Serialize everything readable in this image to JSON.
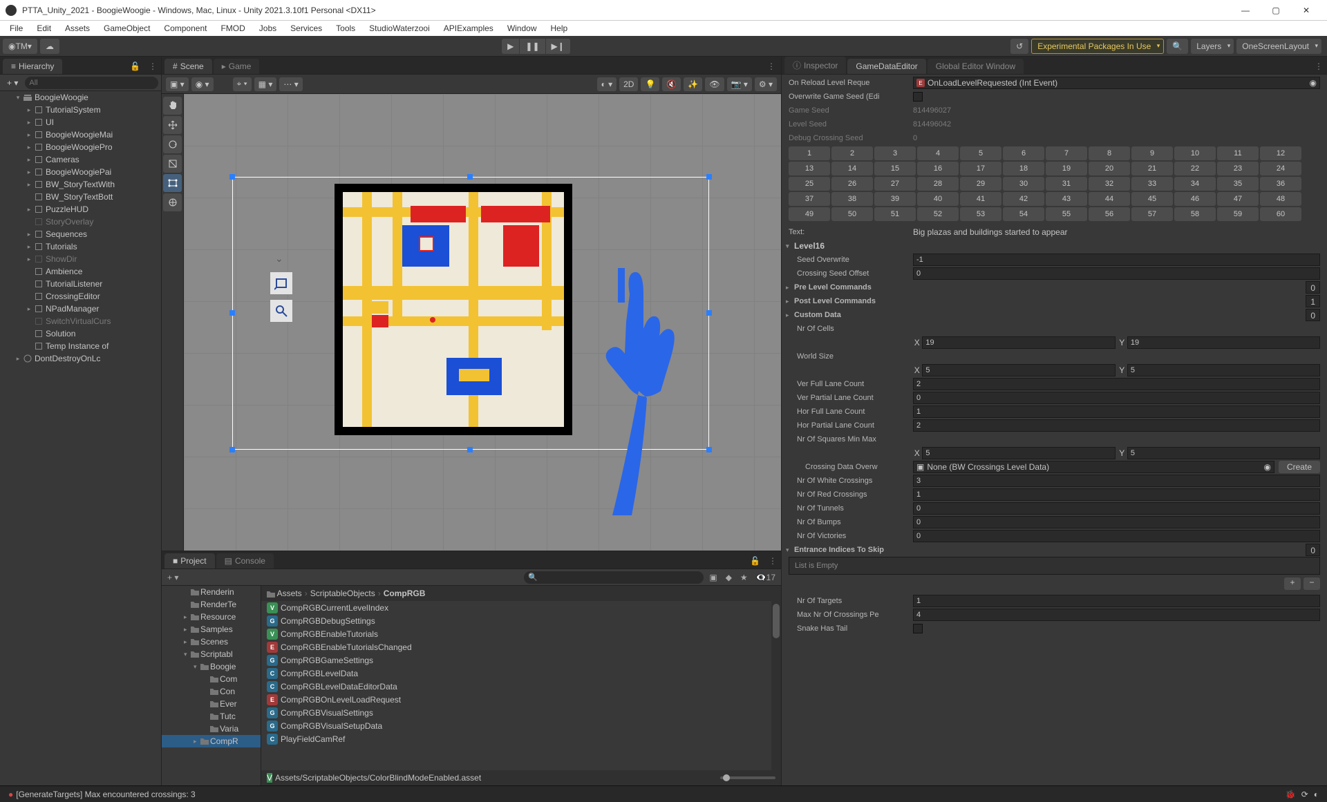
{
  "title": "PTTA_Unity_2021 - BoogieWoogie - Windows, Mac, Linux - Unity 2021.3.10f1 Personal <DX11>",
  "menu": [
    "File",
    "Edit",
    "Assets",
    "GameObject",
    "Component",
    "FMOD",
    "Jobs",
    "Services",
    "Tools",
    "StudioWaterzooi",
    "APIExamples",
    "Window",
    "Help"
  ],
  "toolbar": {
    "tm_label": "TM",
    "exp_packages": "Experimental Packages In Use",
    "layers": "Layers",
    "layout": "OneScreenLayout"
  },
  "hierarchy": {
    "title": "Hierarchy",
    "search_placeholder": "All",
    "scene_name": "BoogieWoogie",
    "items": [
      {
        "name": "TutorialSystem",
        "ind": 2,
        "dim": false,
        "fold": "▸"
      },
      {
        "name": "UI",
        "ind": 2,
        "dim": false,
        "fold": "▸"
      },
      {
        "name": "BoogieWoogieMai",
        "ind": 2,
        "dim": false,
        "fold": "▸"
      },
      {
        "name": "BoogieWoogiePro",
        "ind": 2,
        "dim": false,
        "fold": "▸"
      },
      {
        "name": "Cameras",
        "ind": 2,
        "dim": false,
        "fold": "▸"
      },
      {
        "name": "BoogieWoogiePai",
        "ind": 2,
        "dim": false,
        "fold": "▸"
      },
      {
        "name": "BW_StoryTextWith",
        "ind": 2,
        "dim": false,
        "fold": "▸"
      },
      {
        "name": "BW_StoryTextBott",
        "ind": 2,
        "dim": false,
        "fold": ""
      },
      {
        "name": "PuzzleHUD",
        "ind": 2,
        "dim": false,
        "fold": "▸"
      },
      {
        "name": "StoryOverlay",
        "ind": 2,
        "dim": true,
        "fold": ""
      },
      {
        "name": "Sequences",
        "ind": 2,
        "dim": false,
        "fold": "▸"
      },
      {
        "name": "Tutorials",
        "ind": 2,
        "dim": false,
        "fold": "▸"
      },
      {
        "name": "ShowDir",
        "ind": 2,
        "dim": true,
        "fold": "▸"
      },
      {
        "name": "Ambience",
        "ind": 2,
        "dim": false,
        "fold": ""
      },
      {
        "name": "TutorialListener",
        "ind": 2,
        "dim": false,
        "fold": ""
      },
      {
        "name": "CrossingEditor",
        "ind": 2,
        "dim": false,
        "fold": ""
      },
      {
        "name": "NPadManager",
        "ind": 2,
        "dim": false,
        "fold": "▸"
      },
      {
        "name": "SwitchVirtualCurs",
        "ind": 2,
        "dim": true,
        "fold": ""
      },
      {
        "name": "Solution",
        "ind": 2,
        "dim": false,
        "fold": ""
      },
      {
        "name": "Temp Instance of",
        "ind": 2,
        "dim": false,
        "fold": ""
      }
    ],
    "ddol": "DontDestroyOnLc"
  },
  "scene": {
    "tabs": [
      "Scene",
      "Game"
    ],
    "two_d": "2D"
  },
  "inspector": {
    "tabs": [
      "Inspector",
      "GameDataEditor",
      "Global Editor Window"
    ],
    "on_reload_label": "On Reload Level Reque",
    "on_reload_val": "OnLoadLevelRequested (Int Event)",
    "overwrite_seed_label": "Overwrite Game Seed (Edi",
    "game_seed_label": "Game Seed",
    "game_seed": "814496027",
    "level_seed_label": "Level Seed",
    "level_seed": "814496042",
    "debug_crossing_label": "Debug Crossing Seed",
    "debug_crossing": "0",
    "text_label": "Text:",
    "text_val": "Big plazas and buildings started to appear",
    "level_header": "Level16",
    "seed_ow_label": "Seed Overwrite",
    "seed_ow": "-1",
    "cross_off_label": "Crossing Seed Offset",
    "cross_off": "0",
    "pre_cmd": "Pre Level Commands",
    "pre_cmd_n": "0",
    "post_cmd": "Post Level Commands",
    "post_cmd_n": "1",
    "custom_data": "Custom Data",
    "custom_data_n": "0",
    "cells_label": "Nr Of Cells",
    "cells_x": "19",
    "cells_y": "19",
    "world_label": "World Size",
    "world_x": "5",
    "world_y": "5",
    "vfull": "Ver Full Lane Count",
    "vfull_v": "2",
    "vpart": "Ver Partial Lane Count",
    "vpart_v": "0",
    "hfull": "Hor Full Lane Count",
    "hfull_v": "1",
    "hpart": "Hor Partial Lane Count",
    "hpart_v": "2",
    "sq_label": "Nr Of Squares Min Max",
    "sq_x": "5",
    "sq_y": "5",
    "cdata_label": "Crossing Data Overw",
    "cdata_val": "None (BW Crossings Level Data)",
    "create": "Create",
    "white_c": "Nr Of White Crossings",
    "white_v": "3",
    "red_c": "Nr Of Red Crossings",
    "red_v": "1",
    "tun": "Nr Of Tunnels",
    "tun_v": "0",
    "bum": "Nr Of Bumps",
    "bum_v": "0",
    "vic": "Nr Of Victories",
    "vic_v": "0",
    "ent_label": "Entrance Indices To Skip",
    "ent_n": "0",
    "list_empty": "List is Empty",
    "targ": "Nr Of Targets",
    "targ_v": "1",
    "maxc": "Max Nr Of Crossings Pe",
    "maxc_v": "4",
    "snake": "Snake Has Tail"
  },
  "project": {
    "tabs": [
      "Project",
      "Console"
    ],
    "hidden_count": "17",
    "folders": [
      {
        "name": "Renderin",
        "ind": 2,
        "fold": ""
      },
      {
        "name": "RenderTe",
        "ind": 2,
        "fold": ""
      },
      {
        "name": "Resource",
        "ind": 2,
        "fold": "▸"
      },
      {
        "name": "Samples",
        "ind": 2,
        "fold": "▸"
      },
      {
        "name": "Scenes",
        "ind": 2,
        "fold": "▸"
      },
      {
        "name": "Scriptabl",
        "ind": 2,
        "fold": "▾"
      },
      {
        "name": "Boogie",
        "ind": 3,
        "fold": "▾"
      },
      {
        "name": "Com",
        "ind": 4,
        "fold": ""
      },
      {
        "name": "Con",
        "ind": 4,
        "fold": ""
      },
      {
        "name": "Ever",
        "ind": 4,
        "fold": ""
      },
      {
        "name": "Tutc",
        "ind": 4,
        "fold": ""
      },
      {
        "name": "Varia",
        "ind": 4,
        "fold": ""
      },
      {
        "name": "CompR",
        "ind": 3,
        "fold": "▸",
        "sel": true
      }
    ],
    "breadcrumb": [
      "Assets",
      "ScriptableObjects",
      "CompRGB"
    ],
    "assets": [
      {
        "i": "V",
        "n": "CompRGBCurrentLevelIndex"
      },
      {
        "i": "G",
        "n": "CompRGBDebugSettings"
      },
      {
        "i": "V",
        "n": "CompRGBEnableTutorials"
      },
      {
        "i": "E",
        "n": "CompRGBEnableTutorialsChanged"
      },
      {
        "i": "G",
        "n": "CompRGBGameSettings"
      },
      {
        "i": "C",
        "n": "CompRGBLevelData"
      },
      {
        "i": "C",
        "n": "CompRGBLevelDataEditorData"
      },
      {
        "i": "E",
        "n": "CompRGBOnLevelLoadRequest"
      },
      {
        "i": "G",
        "n": "CompRGBVisualSettings"
      },
      {
        "i": "G",
        "n": "CompRGBVisualSetupData"
      },
      {
        "i": "C",
        "n": "PlayFieldCamRef"
      }
    ],
    "footer_asset": "Assets/ScriptableObjects/ColorBlindModeEnabled.asset",
    "footer_icon": "V"
  },
  "status": {
    "msg": "[GenerateTargets] Max encountered crossings: 3"
  }
}
